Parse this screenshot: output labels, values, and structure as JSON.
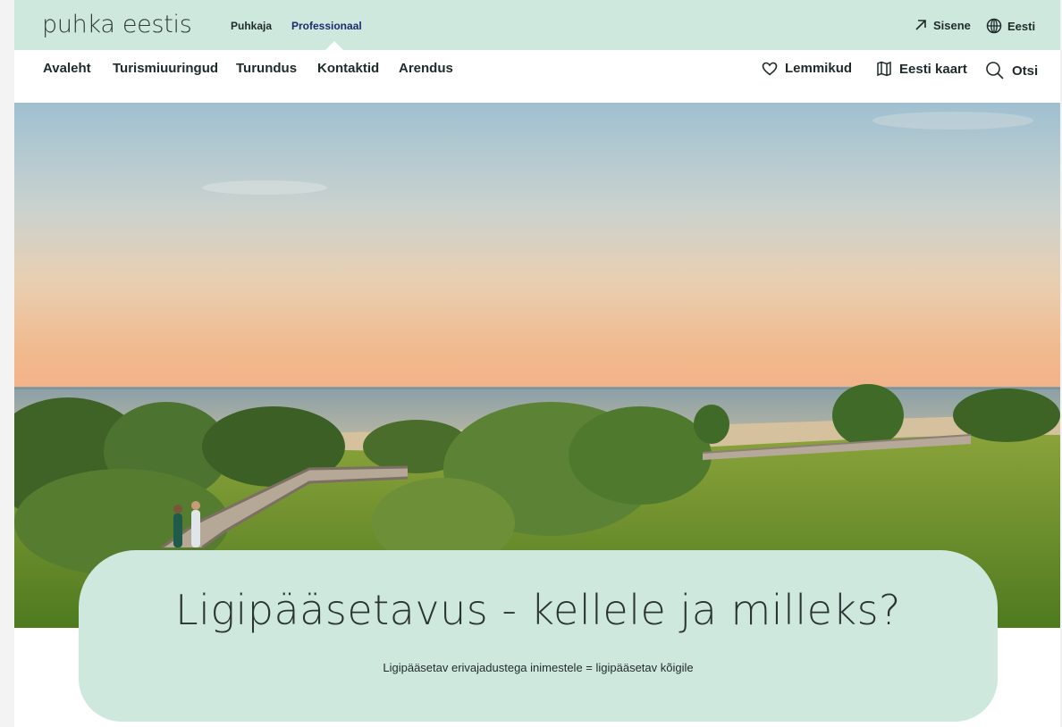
{
  "brand": {
    "name": "puhka eestis"
  },
  "audience_tabs": [
    {
      "label": "Puhkaja"
    },
    {
      "label": "Professionaal"
    }
  ],
  "top_links": {
    "login_label": "Sisene",
    "language_label": "Eesti"
  },
  "main_nav": [
    {
      "label": "Avaleht"
    },
    {
      "label": "Turismiuuringud"
    },
    {
      "label": "Turundus"
    },
    {
      "label": "Kontaktid"
    },
    {
      "label": "Arendus"
    }
  ],
  "utility_nav": [
    {
      "label": "Lemmikud",
      "icon": "heart-icon"
    },
    {
      "label": "Eesti kaart",
      "icon": "map-icon"
    },
    {
      "label": "Otsi",
      "icon": "search-icon"
    }
  ],
  "hero": {
    "title": "Ligipääsetavus - kellele ja milleks?",
    "subtitle": "Ligipääsetav erivajadustega inimestele = ligipääsetav kõigile"
  },
  "colors": {
    "mint": "#cfe8dd",
    "navy_active": "#1e2a6e",
    "text": "#1f2a2a"
  }
}
